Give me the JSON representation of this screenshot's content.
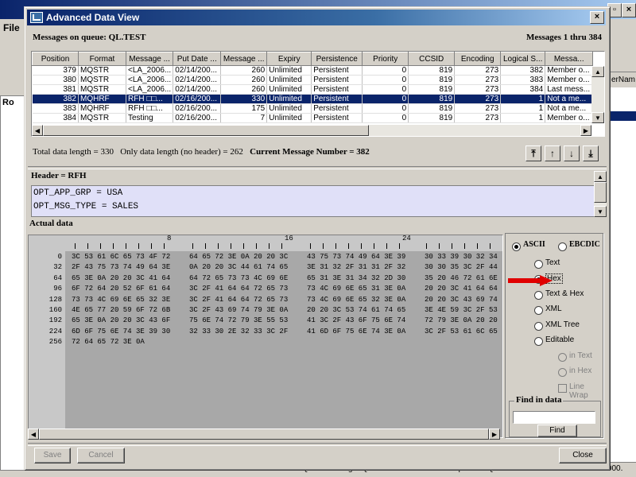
{
  "background": {
    "menu_file": "File",
    "tree_item": "Ro",
    "right_column_label": "erNam",
    "status_text": "Queue Manager QM1 is installed with WebSphere MQ Version 5.3.0 on Windows NT/2000."
  },
  "dialog": {
    "title": "Advanced Data View",
    "queue_label": "Messages on queue: QL.TEST",
    "range_label": "Messages 1 thru 384",
    "close_glyph": "×"
  },
  "table": {
    "columns": [
      "Position",
      "Format",
      "Message ...",
      "Put Date ...",
      "Message ...",
      "Expiry",
      "Persistence",
      "Priority",
      "CCSID",
      "Encoding",
      "Logical S...",
      "Messa..."
    ],
    "rows": [
      [
        "379",
        "MQSTR",
        "<LA_2006...",
        "02/14/200...",
        "260",
        "Unlimited",
        "Persistent",
        "0",
        "819",
        "273",
        "382",
        "Member o..."
      ],
      [
        "380",
        "MQSTR",
        "<LA_2006...",
        "02/14/200...",
        "260",
        "Unlimited",
        "Persistent",
        "0",
        "819",
        "273",
        "383",
        "Member o..."
      ],
      [
        "381",
        "MQSTR",
        "<LA_2006...",
        "02/14/200...",
        "260",
        "Unlimited",
        "Persistent",
        "0",
        "819",
        "273",
        "384",
        "Last mess..."
      ],
      [
        "382",
        "MQHRF",
        "RFH □□...",
        "02/16/200...",
        "330",
        "Unlimited",
        "Persistent",
        "0",
        "819",
        "273",
        "1",
        "Not a me..."
      ],
      [
        "383",
        "MQHRF",
        "RFH □□...",
        "02/16/200...",
        "175",
        "Unlimited",
        "Persistent",
        "0",
        "819",
        "273",
        "1",
        "Not a me..."
      ],
      [
        "384",
        "MQSTR",
        "Testing",
        "02/16/200...",
        "7",
        "Unlimited",
        "Persistent",
        "0",
        "819",
        "273",
        "1",
        "Member o..."
      ]
    ],
    "selected_row": 3
  },
  "summary": {
    "total": "Total data length = 330",
    "only": "Only data length (no header) = 262",
    "current": "Current Message Number = 382"
  },
  "header": {
    "label": "Header = RFH",
    "lines": [
      "OPT_APP_GRP = USA",
      "OPT_MSG_TYPE = SALES"
    ]
  },
  "data": {
    "label": "Actual data",
    "ruler_marks": [
      "8",
      "16",
      "24"
    ],
    "offsets": [
      "0",
      "32",
      "64",
      "96",
      "128",
      "160",
      "192",
      "224",
      "256"
    ],
    "rows": [
      [
        "3C 53 61 6C 65 73 4F 72",
        "64 65 72 3E 0A 20 20 3C",
        "43 75 73 74 49 64 3E 39",
        "30 33 39 30 32 34"
      ],
      [
        "2F 43 75 73 74 49 64 3E",
        "0A 20 20 3C 44 61 74 65",
        "3E 31 32 2F 31 31 2F 32",
        "30 30 35 3C 2F 44"
      ],
      [
        "65 3E 0A 20 20 3C 41 64",
        "64 72 65 73 73 4C 69 6E",
        "65 31 3E 31 34 32 2D 30",
        "35 20 46 72 61 6E"
      ],
      [
        "6F 72 64 20 52 6F 61 64",
        "3C 2F 41 64 64 72 65 73",
        "73 4C 69 6E 65 31 3E 0A",
        "20 20 3C 41 64 64"
      ],
      [
        "73 73 4C 69 6E 65 32 3E",
        "3C 2F 41 64 64 72 65 73",
        "73 4C 69 6E 65 32 3E 0A",
        "20 20 3C 43 69 74"
      ],
      [
        "4E 65 77 20 59 6F 72 6B",
        "3C 2F 43 69 74 79 3E 0A",
        "20 20 3C 53 74 61 74 65",
        "3E 4E 59 3C 2F 53"
      ],
      [
        "65 3E 0A 20 20 3C 43 6F",
        "75 6E 74 72 79 3E 55 53",
        "41 3C 2F 43 6F 75 6E 74",
        "72 79 3E 0A 20 20"
      ],
      [
        "6D 6F 75 6E 74 3E 39 30",
        "32 33 30 2E 32 33 3C 2F",
        "41 6D 6F 75 6E 74 3E 0A",
        "3C 2F 53 61 6C 65"
      ],
      [
        "72 64 65 72 3E 0A",
        "",
        "",
        ""
      ]
    ]
  },
  "options": {
    "ascii": "ASCII",
    "ebcdic": "EBCDIC",
    "text": "Text",
    "hex": "Hex",
    "text_hex": "Text & Hex",
    "xml": "XML",
    "xml_tree": "XML Tree",
    "editable": "Editable",
    "in_text": "in Text",
    "in_hex": "in Hex",
    "line_wrap": "Line Wrap",
    "find_title": "Find in data",
    "find_value": "",
    "find_button": "Find"
  },
  "buttons": {
    "save": "Save",
    "cancel": "Cancel",
    "close": "Close"
  },
  "colors": {
    "selection": "#0a246a",
    "header_bg": "#e0e0f8",
    "arrow": "#e00000"
  }
}
